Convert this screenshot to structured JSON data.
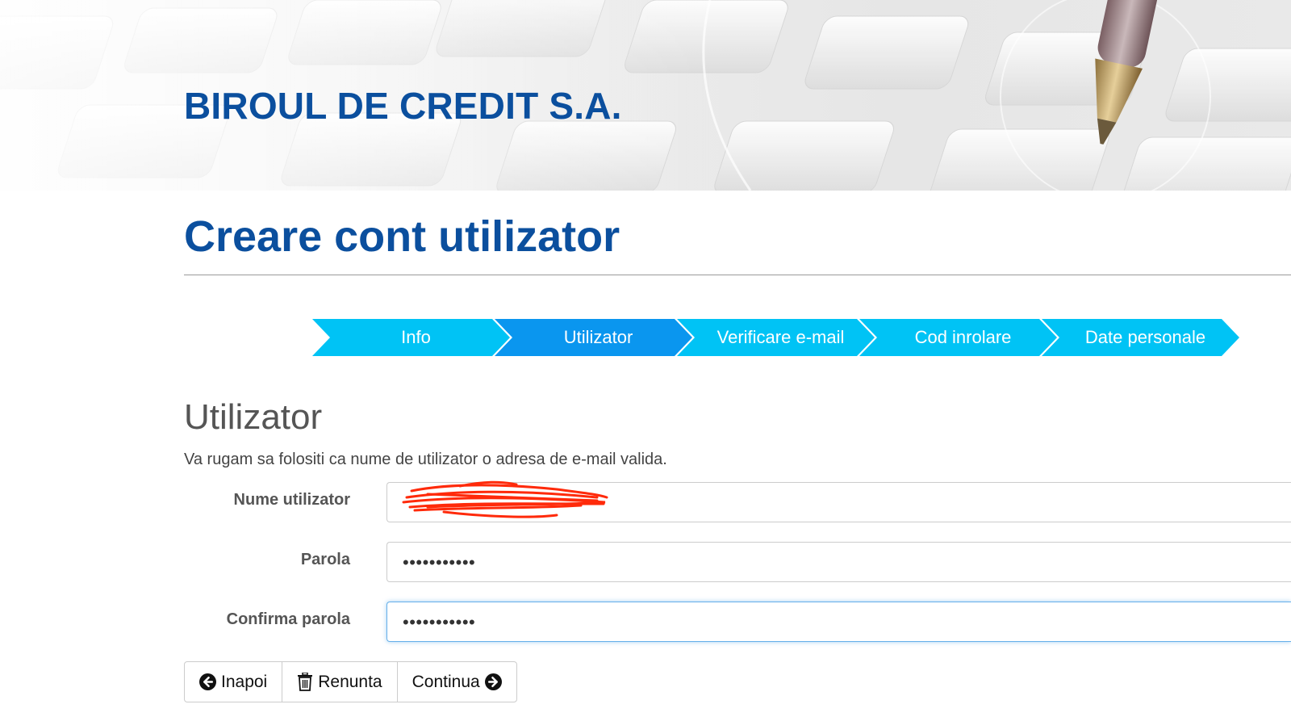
{
  "banner": {
    "title": "BIROUL DE CREDIT S.A."
  },
  "page": {
    "title": "Creare cont utilizator"
  },
  "steps": [
    {
      "label": "Info",
      "active": false
    },
    {
      "label": "Utilizator",
      "active": true
    },
    {
      "label": "Verificare e-mail",
      "active": false
    },
    {
      "label": "Cod inrolare",
      "active": false
    },
    {
      "label": "Date personale",
      "active": false
    }
  ],
  "colors": {
    "brand_blue": "#0b4f9e",
    "step_inactive": "#00c3f5",
    "step_active": "#0a96ef",
    "focus_border": "#66afe9"
  },
  "section": {
    "title": "Utilizator",
    "description": "Va rugam sa folositi ca nume de utilizator o adresa de e-mail valida."
  },
  "form": {
    "username": {
      "label": "Nume utilizator",
      "value": ""
    },
    "password": {
      "label": "Parola",
      "value": "•••••••••••"
    },
    "confirm_password": {
      "label": "Confirma parola",
      "value": "•••••••••••"
    }
  },
  "buttons": {
    "back": {
      "label": "Inapoi",
      "icon": "arrow-left-circle-icon"
    },
    "cancel": {
      "label": "Renunta",
      "icon": "trash-icon"
    },
    "continue": {
      "label": "Continua",
      "icon": "arrow-right-circle-icon"
    }
  }
}
